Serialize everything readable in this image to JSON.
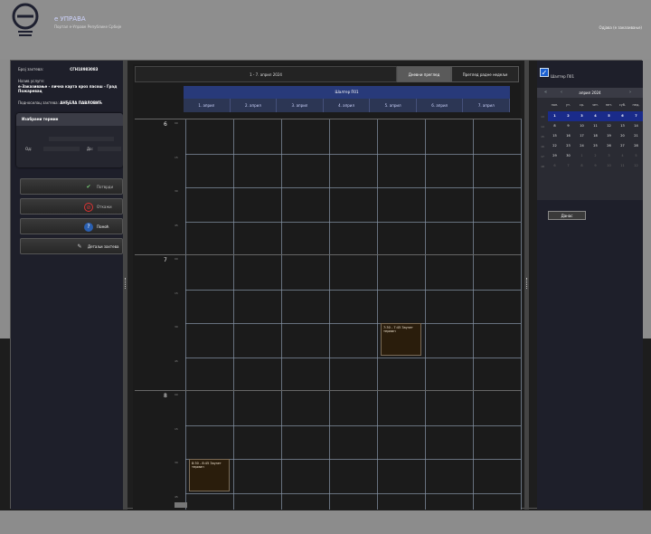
{
  "header": {
    "brand_title": "e УПРАВА",
    "brand_sub": "Портал е-Управе Републике Србије",
    "logout": "Одјава (е заказивање)"
  },
  "left": {
    "fields": [
      {
        "label": "Број захтева:",
        "value": "СГН18983083"
      },
      {
        "label": "Назив услуге:",
        "value": ""
      },
      {
        "label": "",
        "value": "е-Заказивање - лична карта кроз пасош - Град Пожаревац"
      },
      {
        "label": "Подносилац захтева:",
        "value": "АНЂЕЛА ПАВЛОВИЋ"
      }
    ],
    "select_title": "Изабрани термин",
    "from_label": "Од:",
    "to_label": "До:",
    "buttons": [
      {
        "label": "Потврди",
        "icon": "check-icon"
      },
      {
        "label": "Откажи",
        "icon": "cancel-icon"
      },
      {
        "label": "Помоћ",
        "icon": "help-icon"
      },
      {
        "label": "Детаљи захтева",
        "icon": "pencil-icon"
      }
    ]
  },
  "center": {
    "range": "1 - 7. април 2024",
    "tab_day": "Дневни преглед",
    "tab_week": "Преглед радне недеље",
    "resource": "Шалтер П01",
    "days": [
      "1. април",
      "2. април",
      "3. април",
      "4. април",
      "5. април",
      "6. април",
      "7. април"
    ],
    "hours": [
      "6",
      "7",
      "8"
    ],
    "quarters": [
      "00",
      "15",
      "30",
      "45"
    ],
    "appointments": [
      {
        "text": "7:30 - 7:45 Заузет термин",
        "day": 5,
        "hour": 7,
        "quarter": 2
      },
      {
        "text": "8:30 - 8:45 Заузет термин",
        "day": 1,
        "hour": 8,
        "quarter": 2
      }
    ]
  },
  "right": {
    "checkbox_label": "Шалтер П01",
    "month": "април 2024",
    "weekdays": [
      "пон.",
      "ут.",
      "ср.",
      "чет.",
      "пет.",
      "суб.",
      "нед."
    ],
    "weeks": [
      {
        "num": "13",
        "days": [
          "1",
          "2",
          "3",
          "4",
          "5",
          "6",
          "7"
        ]
      },
      {
        "num": "14",
        "days": [
          "8",
          "9",
          "10",
          "11",
          "12",
          "13",
          "14"
        ]
      },
      {
        "num": "15",
        "days": [
          "15",
          "16",
          "17",
          "18",
          "19",
          "20",
          "21"
        ]
      },
      {
        "num": "16",
        "days": [
          "22",
          "23",
          "24",
          "25",
          "26",
          "27",
          "28"
        ]
      },
      {
        "num": "17",
        "days": [
          "29",
          "30",
          "1",
          "2",
          "3",
          "4",
          "5"
        ]
      },
      {
        "num": "18",
        "days": [
          "6",
          "7",
          "8",
          "9",
          "10",
          "11",
          "12"
        ]
      }
    ],
    "today": "Данас"
  }
}
